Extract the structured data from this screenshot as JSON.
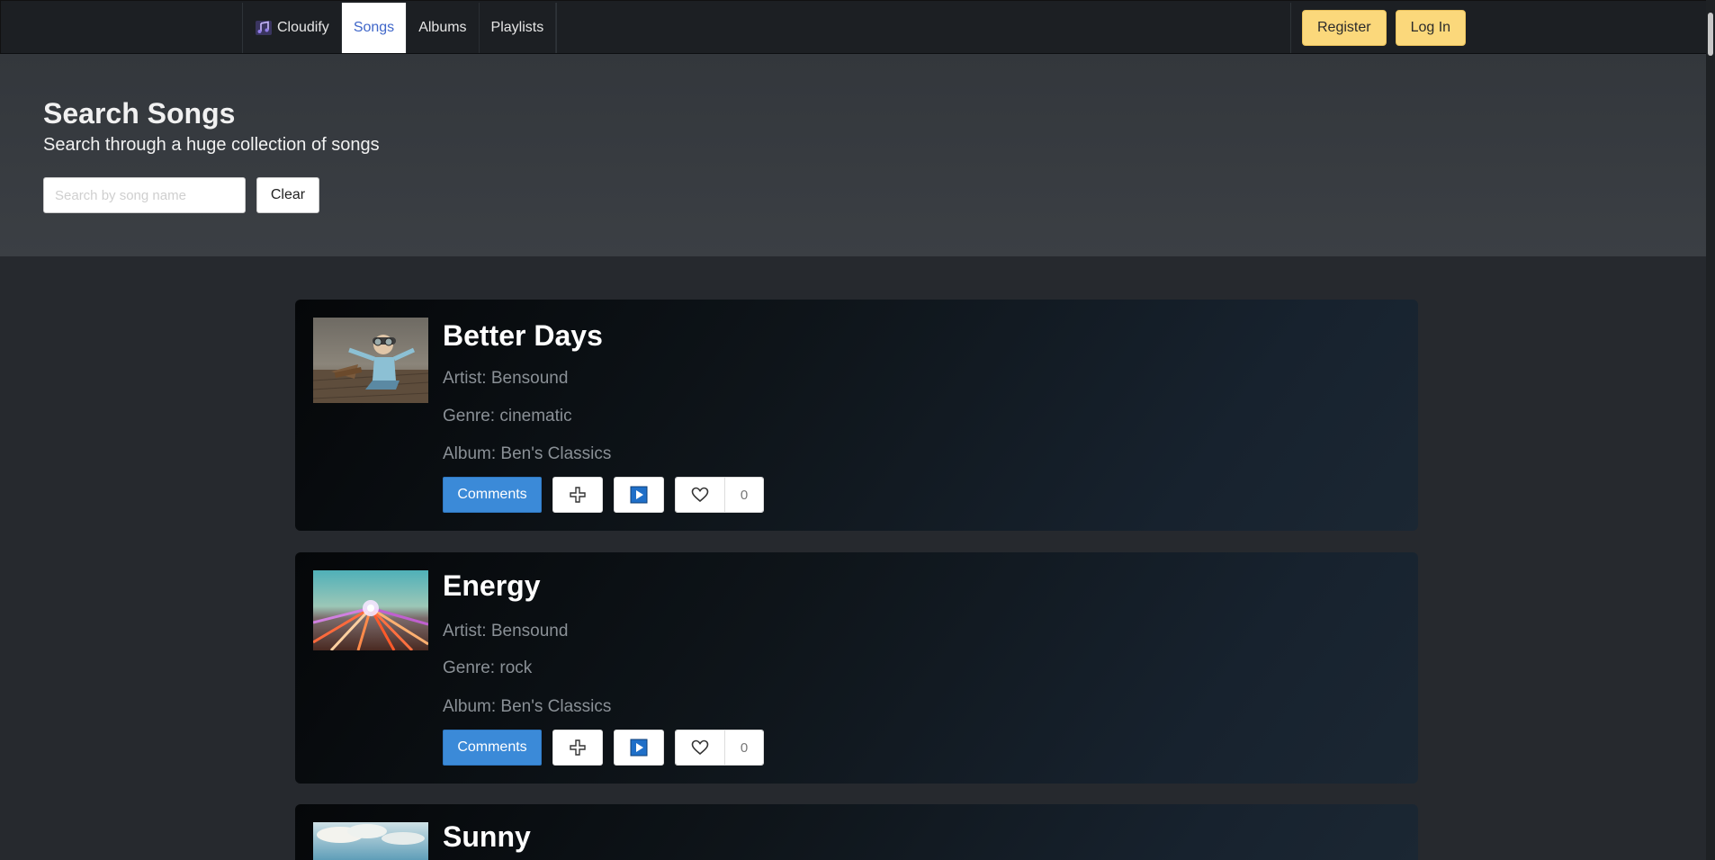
{
  "nav": {
    "brand": "Cloudify",
    "tabs": [
      {
        "label": "Songs",
        "active": true
      },
      {
        "label": "Albums",
        "active": false
      },
      {
        "label": "Playlists",
        "active": false
      }
    ],
    "register_label": "Register",
    "login_label": "Log In"
  },
  "hero": {
    "title": "Search Songs",
    "subtitle": "Search through a huge collection of songs",
    "search_placeholder": "Search by song name",
    "clear_label": "Clear"
  },
  "songs": [
    {
      "title": "Better Days",
      "artist": "Artist: Bensound",
      "genre": "Genre: cinematic",
      "album": "Album: Ben's Classics",
      "comments_label": "Comments",
      "likes": "0"
    },
    {
      "title": "Energy",
      "artist": "Artist: Bensound",
      "genre": "Genre: rock",
      "album": "Album: Ben's Classics",
      "comments_label": "Comments",
      "likes": "0"
    },
    {
      "title": "Sunny"
    }
  ],
  "colors": {
    "accent_blue": "#3b8ad8",
    "auth_button_yellow": "#fbd87b",
    "active_tab_text": "#3f66c9"
  }
}
